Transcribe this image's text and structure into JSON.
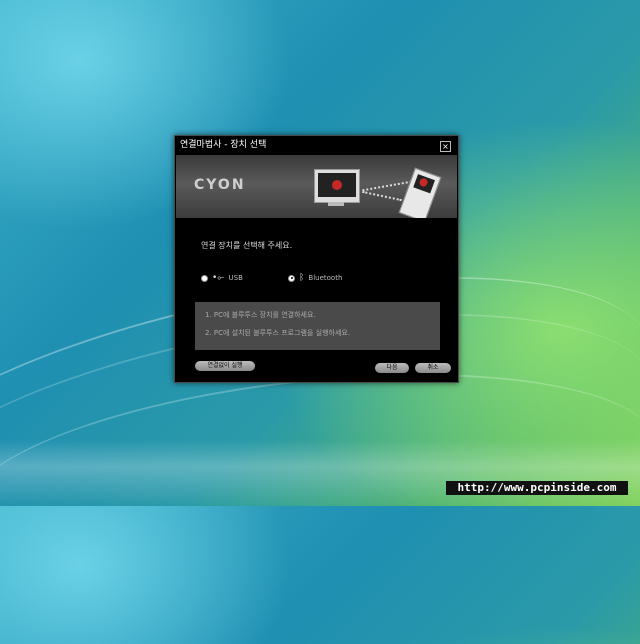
{
  "dialog": {
    "title": "연결마법사 - 장치 선택",
    "close_glyph": "×",
    "brand": "CYON",
    "prompt": "연결 장치를 선택해 주세요.",
    "options": [
      {
        "label": "USB",
        "selected": false,
        "icon": "usb-icon"
      },
      {
        "label": "Bluetooth",
        "selected": true,
        "icon": "bluetooth-icon"
      }
    ],
    "info_lines": [
      "1. PC에 블루투스 장치를 연결하세요.",
      "2. PC에 설치된 블루투스 프로그램을 실행하세요."
    ],
    "buttons": {
      "run_without_connect": "연결없이 실행",
      "next": "다음",
      "cancel": "취소"
    }
  },
  "watermark": "http://www.pcpinside.com"
}
